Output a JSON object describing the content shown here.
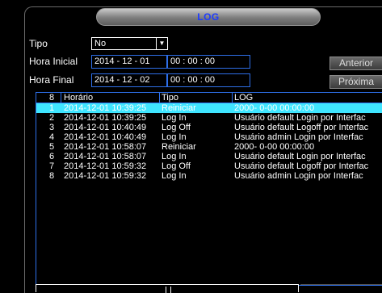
{
  "window": {
    "title": "LOG"
  },
  "filters": {
    "type_label": "Tipo",
    "type_value": "No",
    "start_label": "Hora Inicial",
    "start_date": "2014 - 12 - 01",
    "start_time": "00 : 00 : 00",
    "end_label": "Hora Final",
    "end_date": "2014 - 12 - 02",
    "end_time": "00 : 00 : 00"
  },
  "buttons": {
    "prev": "Anterior",
    "next": "Próxima"
  },
  "table": {
    "headers": {
      "index": "8",
      "time": "Horário",
      "type": "Tipo",
      "log": "LOG"
    },
    "rows": [
      {
        "n": "1",
        "time": "2014-12-01 10:39:25",
        "type": "Reiniciar",
        "log": "2000- 0-00 00:00:00",
        "selected": true
      },
      {
        "n": "2",
        "time": "2014-12-01 10:39:25",
        "type": "Log In",
        "log": "Usuário default Login por Interfac"
      },
      {
        "n": "3",
        "time": "2014-12-01 10:40:49",
        "type": "Log Off",
        "log": "Usuário default Logoff por Interfac"
      },
      {
        "n": "4",
        "time": "2014-12-01 10:40:49",
        "type": "Log In",
        "log": "Usuário admin Login por Interfac"
      },
      {
        "n": "5",
        "time": "2014-12-01 10:58:07",
        "type": "Reiniciar",
        "log": "2000- 0-00 00:00:00"
      },
      {
        "n": "6",
        "time": "2014-12-01 10:58:07",
        "type": "Log In",
        "log": "Usuário default Login por Interfac"
      },
      {
        "n": "7",
        "time": "2014-12-01 10:59:32",
        "type": "Log Off",
        "log": "Usuário default Logoff por Interfac"
      },
      {
        "n": "8",
        "time": "2014-12-01 10:59:32",
        "type": "Log In",
        "log": "Usuário admin Login por Interfac"
      }
    ]
  },
  "colors": {
    "accent": "#2e6fe8",
    "selected_row": "#3fe5ff",
    "title_text": "#1e3cff"
  }
}
